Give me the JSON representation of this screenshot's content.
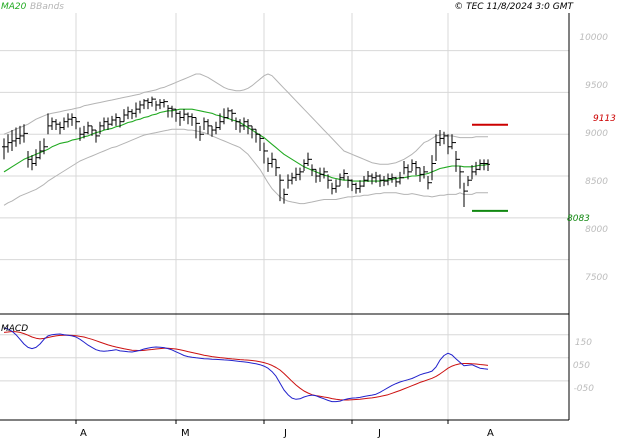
{
  "header": {
    "ma_label": "MA20",
    "bb_label": "BBands",
    "copyright": "© TEC 11/8/2024 3:0 GMT"
  },
  "colors": {
    "background": "#ffffff",
    "grid": "#d8d8d8",
    "axis": "#000000",
    "tick_text": "#bcbcbc",
    "candle": "#000000",
    "ma": "#22aa22",
    "bbands": "#b4b4b4",
    "macd": "#2222cc",
    "signal": "#cc1111",
    "resistance": "#cc0000",
    "support": "#118811"
  },
  "chart_data": [
    {
      "type": "line",
      "name": "price-panel",
      "ylim": [
        6850,
        10450
      ],
      "yticks": [
        10000,
        9500,
        9000,
        8500,
        8000,
        7500
      ],
      "ytick_labels": [
        "10000",
        "9500",
        "9000",
        "8500",
        "8000",
        "7500"
      ],
      "grid": true,
      "months": [
        {
          "label": "A",
          "x": 18
        },
        {
          "label": "M",
          "x": 43
        },
        {
          "label": "J",
          "x": 65
        },
        {
          "label": "J",
          "x": 87
        },
        {
          "label": "A",
          "x": 111
        }
      ],
      "x_range": [
        0,
        133
      ],
      "close": [
        8850,
        8900,
        8920,
        8950,
        8980,
        9010,
        8700,
        8650,
        8720,
        8800,
        8850,
        9100,
        9150,
        9120,
        9080,
        9150,
        9180,
        9200,
        9150,
        9000,
        9020,
        9100,
        9050,
        8980,
        9100,
        9150,
        9120,
        9170,
        9200,
        9150,
        9230,
        9270,
        9250,
        9300,
        9350,
        9400,
        9380,
        9420,
        9350,
        9380,
        9390,
        9310,
        9300,
        9250,
        9200,
        9240,
        9210,
        9200,
        9130,
        9000,
        9150,
        9100,
        9050,
        9080,
        9150,
        9200,
        9280,
        9250,
        9150,
        9100,
        9150,
        9100,
        9060,
        9000,
        8950,
        8800,
        8650,
        8700,
        8600,
        8450,
        8280,
        8450,
        8480,
        8520,
        8550,
        8650,
        8700,
        8580,
        8500,
        8520,
        8550,
        8450,
        8350,
        8380,
        8480,
        8530,
        8450,
        8400,
        8350,
        8380,
        8450,
        8500,
        8480,
        8500,
        8450,
        8440,
        8470,
        8480,
        8430,
        8480,
        8600,
        8550,
        8650,
        8600,
        8520,
        8550,
        8420,
        8650,
        8900,
        8950,
        8980,
        8850,
        8900,
        8700,
        8550,
        8320,
        8450,
        8550,
        8580,
        8650,
        8650,
        8640
      ],
      "highs": [
        8950,
        9000,
        9050,
        9080,
        9100,
        9120,
        8800,
        8750,
        8820,
        8920,
        8950,
        9250,
        9200,
        9180,
        9150,
        9200,
        9250,
        9250,
        9200,
        9080,
        9100,
        9150,
        9100,
        9050,
        9150,
        9200,
        9200,
        9220,
        9250,
        9200,
        9300,
        9330,
        9300,
        9380,
        9400,
        9420,
        9430,
        9450,
        9400,
        9420,
        9420,
        9350,
        9340,
        9300,
        9280,
        9300,
        9260,
        9250,
        9200,
        9100,
        9200,
        9180,
        9100,
        9150,
        9250,
        9310,
        9320,
        9300,
        9200,
        9180,
        9200,
        9180,
        9100,
        9060,
        9000,
        8900,
        8720,
        8780,
        8700,
        8520,
        8350,
        8520,
        8540,
        8600,
        8600,
        8700,
        8780,
        8640,
        8580,
        8600,
        8600,
        8520,
        8420,
        8460,
        8530,
        8580,
        8500,
        8460,
        8420,
        8450,
        8500,
        8560,
        8530,
        8550,
        8520,
        8500,
        8530,
        8530,
        8490,
        8550,
        8680,
        8640,
        8700,
        8680,
        8600,
        8620,
        8500,
        8750,
        9000,
        9050,
        9030,
        9000,
        9000,
        8800,
        8620,
        8420,
        8500,
        8630,
        8670,
        8700,
        8700,
        8700
      ],
      "lows": [
        8700,
        8780,
        8800,
        8850,
        8880,
        8900,
        8600,
        8570,
        8620,
        8700,
        8760,
        9000,
        9050,
        9050,
        9000,
        9050,
        9080,
        9100,
        9060,
        8920,
        8950,
        9000,
        8980,
        8900,
        9000,
        9050,
        9050,
        9100,
        9100,
        9080,
        9150,
        9180,
        9180,
        9200,
        9250,
        9300,
        9300,
        9330,
        9280,
        9300,
        9320,
        9200,
        9200,
        9150,
        9100,
        9160,
        9120,
        9100,
        8950,
        8920,
        9050,
        9000,
        8970,
        9000,
        9050,
        9120,
        9180,
        9150,
        9050,
        9020,
        9050,
        9000,
        8950,
        8900,
        8800,
        8650,
        8550,
        8600,
        8500,
        8200,
        8170,
        8350,
        8400,
        8440,
        8450,
        8560,
        8620,
        8500,
        8420,
        8430,
        8470,
        8350,
        8280,
        8300,
        8380,
        8450,
        8360,
        8320,
        8290,
        8300,
        8370,
        8430,
        8400,
        8420,
        8370,
        8380,
        8390,
        8420,
        8370,
        8400,
        8520,
        8460,
        8560,
        8510,
        8430,
        8470,
        8340,
        8450,
        8680,
        8860,
        8880,
        8760,
        8820,
        8550,
        8350,
        8130,
        8380,
        8460,
        8510,
        8570,
        8570,
        8560
      ],
      "ma20": [
        8550,
        8580,
        8610,
        8640,
        8670,
        8700,
        8720,
        8740,
        8760,
        8780,
        8800,
        8820,
        8850,
        8870,
        8890,
        8900,
        8910,
        8930,
        8940,
        8950,
        8970,
        8980,
        9000,
        9020,
        9030,
        9050,
        9060,
        9070,
        9090,
        9100,
        9120,
        9140,
        9150,
        9170,
        9180,
        9200,
        9210,
        9230,
        9240,
        9260,
        9270,
        9280,
        9280,
        9290,
        9300,
        9300,
        9300,
        9300,
        9290,
        9280,
        9270,
        9260,
        9250,
        9230,
        9220,
        9200,
        9190,
        9170,
        9160,
        9140,
        9110,
        9080,
        9050,
        9020,
        8990,
        8960,
        8920,
        8880,
        8840,
        8800,
        8760,
        8730,
        8700,
        8670,
        8640,
        8610,
        8590,
        8570,
        8550,
        8530,
        8510,
        8500,
        8480,
        8470,
        8460,
        8450,
        8450,
        8440,
        8440,
        8440,
        8440,
        8440,
        8440,
        8440,
        8440,
        8450,
        8450,
        8460,
        8470,
        8480,
        8480,
        8490,
        8500,
        8500,
        8510,
        8520,
        8530,
        8550,
        8570,
        8590,
        8600,
        8610,
        8620,
        8620,
        8620,
        8610,
        8610,
        8610,
        8620,
        8630,
        8630,
        8640
      ],
      "bb_upper": [
        9000,
        9020,
        9040,
        9060,
        9080,
        9100,
        9120,
        9150,
        9180,
        9200,
        9220,
        9240,
        9250,
        9260,
        9270,
        9280,
        9290,
        9300,
        9310,
        9320,
        9340,
        9350,
        9360,
        9370,
        9380,
        9390,
        9400,
        9410,
        9420,
        9430,
        9440,
        9450,
        9460,
        9470,
        9480,
        9500,
        9510,
        9520,
        9530,
        9550,
        9560,
        9580,
        9600,
        9620,
        9640,
        9660,
        9680,
        9700,
        9720,
        9720,
        9700,
        9680,
        9650,
        9620,
        9590,
        9560,
        9540,
        9530,
        9520,
        9520,
        9530,
        9550,
        9580,
        9620,
        9660,
        9700,
        9720,
        9700,
        9650,
        9600,
        9550,
        9500,
        9450,
        9400,
        9350,
        9300,
        9250,
        9200,
        9150,
        9100,
        9050,
        9000,
        8950,
        8900,
        8850,
        8800,
        8780,
        8760,
        8740,
        8720,
        8700,
        8680,
        8660,
        8650,
        8640,
        8640,
        8640,
        8650,
        8660,
        8680,
        8700,
        8730,
        8760,
        8800,
        8850,
        8900,
        8920,
        8950,
        8980,
        8990,
        9000,
        8980,
        8980,
        8970,
        8960,
        8960,
        8960,
        8960,
        8970,
        8970,
        8970,
        8970
      ],
      "bb_lower": [
        8150,
        8180,
        8200,
        8230,
        8260,
        8280,
        8300,
        8320,
        8340,
        8370,
        8400,
        8440,
        8470,
        8500,
        8530,
        8560,
        8590,
        8620,
        8650,
        8680,
        8700,
        8720,
        8740,
        8760,
        8780,
        8800,
        8820,
        8840,
        8850,
        8870,
        8890,
        8910,
        8930,
        8950,
        8970,
        8990,
        9000,
        9010,
        9020,
        9030,
        9040,
        9050,
        9060,
        9060,
        9060,
        9060,
        9050,
        9050,
        9040,
        9030,
        9020,
        9000,
        8980,
        8960,
        8940,
        8920,
        8900,
        8880,
        8860,
        8840,
        8800,
        8760,
        8700,
        8640,
        8580,
        8500,
        8420,
        8350,
        8300,
        8250,
        8220,
        8200,
        8190,
        8180,
        8170,
        8170,
        8180,
        8190,
        8200,
        8210,
        8220,
        8220,
        8220,
        8220,
        8230,
        8240,
        8250,
        8250,
        8260,
        8260,
        8270,
        8270,
        8280,
        8290,
        8290,
        8300,
        8300,
        8300,
        8300,
        8290,
        8280,
        8280,
        8290,
        8280,
        8270,
        8260,
        8260,
        8250,
        8260,
        8270,
        8270,
        8280,
        8280,
        8280,
        8300,
        8280,
        8280,
        8280,
        8300,
        8300,
        8300,
        8300
      ],
      "resistance": {
        "value": 9113,
        "label": "9113",
        "x_start": 117,
        "x_end": 126
      },
      "support": {
        "value": 8083,
        "label": "8083",
        "x_start": 117,
        "x_end": 126
      }
    },
    {
      "type": "line",
      "name": "macd-panel",
      "title": "MACD",
      "ylim": [
        -220,
        240
      ],
      "yticks": [
        150,
        50,
        -50
      ],
      "ytick_labels": [
        "150",
        "050",
        "-050"
      ],
      "grid": true,
      "series": [
        {
          "name": "MACD",
          "color": "#2222cc",
          "values": [
            180,
            175,
            165,
            150,
            130,
            110,
            95,
            90,
            95,
            110,
            130,
            145,
            150,
            152,
            153,
            150,
            148,
            145,
            140,
            130,
            118,
            105,
            95,
            85,
            80,
            78,
            80,
            82,
            85,
            80,
            78,
            76,
            75,
            78,
            82,
            88,
            92,
            95,
            97,
            96,
            94,
            90,
            84,
            76,
            68,
            60,
            55,
            52,
            50,
            48,
            46,
            45,
            44,
            43,
            42,
            41,
            40,
            38,
            36,
            34,
            32,
            30,
            27,
            24,
            20,
            14,
            5,
            -10,
            -30,
            -60,
            -90,
            -110,
            -125,
            -130,
            -128,
            -120,
            -115,
            -112,
            -115,
            -122,
            -128,
            -135,
            -140,
            -140,
            -138,
            -132,
            -128,
            -125,
            -124,
            -122,
            -118,
            -115,
            -112,
            -108,
            -100,
            -90,
            -80,
            -70,
            -62,
            -55,
            -50,
            -45,
            -40,
            -32,
            -24,
            -18,
            -14,
            -8,
            10,
            40,
            60,
            70,
            62,
            45,
            30,
            15,
            18,
            20,
            12,
            5,
            2,
            0
          ]
        },
        {
          "name": "Signal",
          "color": "#cc1111",
          "values": [
            160,
            162,
            164,
            163,
            160,
            155,
            148,
            140,
            135,
            132,
            134,
            138,
            142,
            145,
            147,
            148,
            148,
            147,
            146,
            143,
            140,
            135,
            130,
            124,
            118,
            112,
            106,
            101,
            97,
            93,
            89,
            86,
            83,
            82,
            81,
            82,
            84,
            86,
            88,
            90,
            91,
            91,
            90,
            88,
            85,
            81,
            77,
            73,
            69,
            65,
            61,
            58,
            55,
            53,
            51,
            49,
            47,
            45,
            44,
            42,
            41,
            40,
            38,
            36,
            33,
            29,
            24,
            17,
            8,
            -3,
            -18,
            -35,
            -52,
            -68,
            -82,
            -94,
            -103,
            -110,
            -114,
            -117,
            -120,
            -123,
            -127,
            -130,
            -132,
            -133,
            -133,
            -132,
            -131,
            -130,
            -128,
            -126,
            -124,
            -121,
            -118,
            -114,
            -110,
            -104,
            -98,
            -92,
            -85,
            -78,
            -71,
            -64,
            -57,
            -51,
            -45,
            -39,
            -31,
            -20,
            -8,
            5,
            14,
            20,
            24,
            25,
            25,
            24,
            23,
            21,
            19,
            17
          ]
        }
      ],
      "x_range": [
        0,
        133
      ]
    }
  ]
}
